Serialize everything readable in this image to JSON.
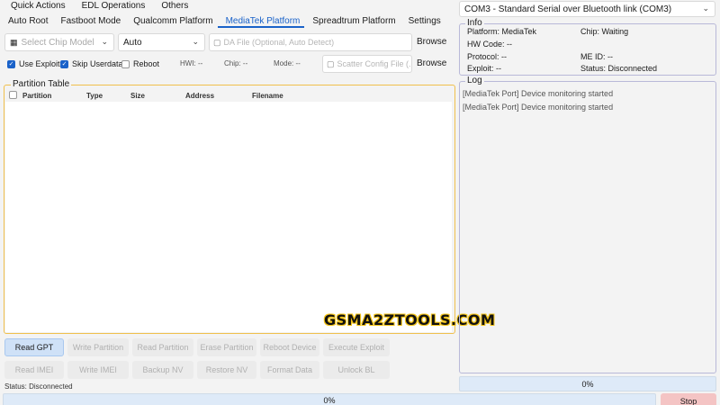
{
  "menu": [
    "Quick Actions",
    "EDL Operations",
    "Others"
  ],
  "tabs": [
    "Auto Root",
    "Fastboot Mode",
    "Qualcomm Platform",
    "MediaTek Platform",
    "Spreadtrum Platform",
    "Settings"
  ],
  "active_tab": "MediaTek Platform",
  "chip_select": {
    "placeholder": "Select Chip Model"
  },
  "mode_select": {
    "value": "Auto"
  },
  "da_file": {
    "placeholder": "DA File (Optional, Auto Detect)",
    "browse": "Browse"
  },
  "scatter_file": {
    "placeholder": "Scatter Config File (...",
    "browse": "Browse"
  },
  "options": [
    {
      "label": "Use Exploit",
      "checked": true
    },
    {
      "label": "Skip Userdata",
      "checked": true
    },
    {
      "label": "Reboot",
      "checked": false
    }
  ],
  "hw_status": {
    "hw": "HWI: --",
    "chip": "Chip: --",
    "mode": "Mode: --"
  },
  "partition_table": {
    "title": "Partition Table",
    "columns": [
      "Partition",
      "Type",
      "Size",
      "Address",
      "Filename"
    ]
  },
  "watermark": "GSMA2ZTOOLS.COM",
  "actions_row1": [
    "Read GPT",
    "Write Partition",
    "Read Partition",
    "Erase Partition",
    "Reboot Device",
    "Execute Exploit"
  ],
  "actions_row2": [
    "Read IMEI",
    "Write IMEI",
    "Backup NV",
    "Restore NV",
    "Format Data",
    "Unlock BL"
  ],
  "status_text": "Status: Disconnected",
  "progress_main": "0%",
  "progress_right": "0%",
  "stop_label": "Stop",
  "port_select": {
    "value": "COM3 - Standard Serial over Bluetooth link (COM3)"
  },
  "info": {
    "title": "Info",
    "platform": "Platform: MediaTek",
    "chip": "Chip: Waiting",
    "hw_code": "HW Code: --",
    "protocol": "Protocol: --",
    "me_id": "ME ID: --",
    "exploit": "Exploit: --",
    "status": "Status: Disconnected"
  },
  "log": {
    "title": "Log",
    "lines": [
      "[MediaTek Port] Device monitoring started",
      "[MediaTek Port] Device monitoring started"
    ]
  },
  "colors": {
    "accent": "#1a62c9",
    "group_border": "#f0c04c",
    "progress_bg": "#deeaf8",
    "stop_bg": "#f4c4c4"
  }
}
